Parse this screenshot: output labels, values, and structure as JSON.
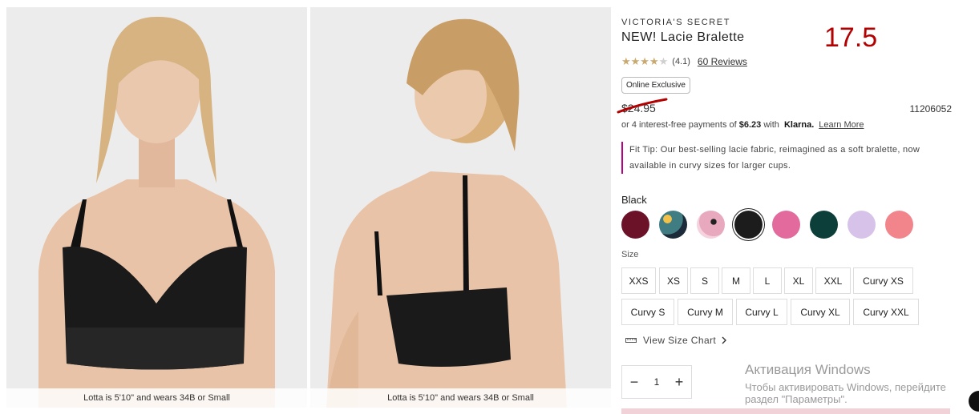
{
  "gallery": {
    "images": [
      {
        "caption": "Lotta is 5'10\" and wears 34B or Small"
      },
      {
        "caption": "Lotta is 5'10\" and wears 34B or Small"
      }
    ]
  },
  "product": {
    "brand": "VICTORIA'S SECRET",
    "title": "NEW! Lacie Bralette",
    "overlay_number": "17.5",
    "rating": {
      "stars": "★★★★",
      "empty_star": "★",
      "value": "(4.1)",
      "reviews": "60 Reviews"
    },
    "badge": "Online Exclusive",
    "price": "$24.95",
    "sku": "11206052",
    "klarna": {
      "prefix": "or 4 interest-free payments of ",
      "amount": "$6.23",
      "with": " with ",
      "logo": "Klarna.",
      "learn_more": "Learn More"
    },
    "fit_tip": {
      "label": "Fit Tip:",
      "text": "Our best-selling lacie fabric, reimagined as a soft bralette, now available in curvy sizes for larger cups."
    },
    "color_selected": "Black",
    "swatches": [
      {
        "name": "burgundy",
        "color": "#6b1228"
      },
      {
        "name": "teal-floral",
        "color": "#3f7d82"
      },
      {
        "name": "pink-floral",
        "color": "#e8a8bd"
      },
      {
        "name": "black",
        "color": "#1c1c1c"
      },
      {
        "name": "hot-pink",
        "color": "#e36a9c"
      },
      {
        "name": "dark-green",
        "color": "#0c3f3a"
      },
      {
        "name": "lavender",
        "color": "#d7c3ea"
      },
      {
        "name": "coral-pink",
        "color": "#f2848c"
      }
    ],
    "size_label": "Size",
    "sizes_row1": [
      "XXS",
      "XS",
      "S",
      "M",
      "L",
      "XL",
      "XXL",
      "Curvy XS"
    ],
    "sizes_row2": [
      "Curvy S",
      "Curvy M",
      "Curvy L",
      "Curvy XL",
      "Curvy XXL"
    ],
    "size_chart": "View Size Chart",
    "quantity": "1",
    "qty_minus": "−",
    "qty_plus": "+"
  },
  "windows_watermark": {
    "line1": "Активация Windows",
    "line2": "Чтобы активировать Windows, перейдите",
    "line3": "раздел \"Параметры\"."
  }
}
